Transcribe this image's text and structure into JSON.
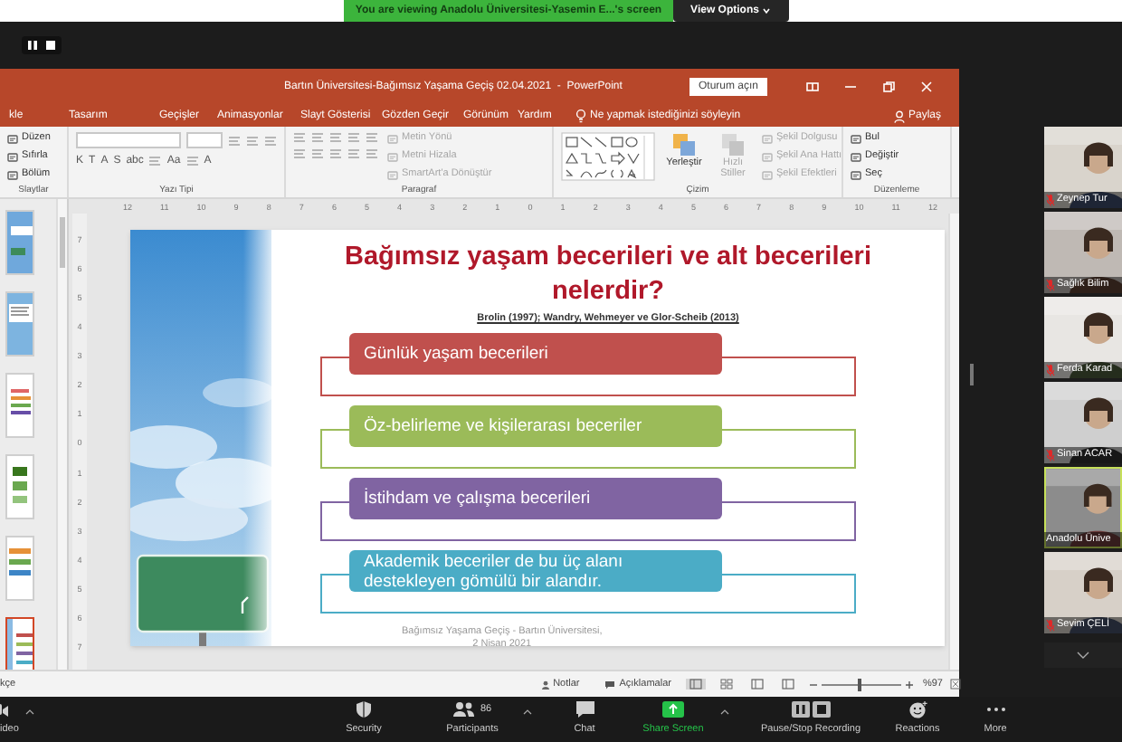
{
  "share_banner": {
    "text": "You are viewing Anadolu Üniversitesi-Yasemin E...'s screen",
    "view_options": "View Options"
  },
  "powerpoint": {
    "title": "Bartın Üniversitesi-Bağımsız Yaşama Geçiş 02.04.2021  -  PowerPoint",
    "sign_in": "Oturum açın",
    "tabs": [
      {
        "label": "kle",
        "selected": false
      },
      {
        "label": "Tasarım",
        "selected": false
      },
      {
        "label": "Geçişler",
        "selected": false
      },
      {
        "label": "Animasyonlar",
        "selected": false
      },
      {
        "label": "Slayt Gösterisi",
        "selected": false
      },
      {
        "label": "Gözden Geçir",
        "selected": false
      },
      {
        "label": "Görünüm",
        "selected": false
      },
      {
        "label": "Yardım",
        "selected": false
      }
    ],
    "tell_me": "Ne yapmak istediğinizi söyleyin",
    "share": "Paylaş",
    "ribbon": [
      {
        "label": "Slaytlar",
        "columns": [
          [
            [
              {
                "kind": "button",
                "label": "Düzen",
                "disabled": false
              }
            ],
            [
              {
                "kind": "button",
                "label": "Sıfırla",
                "disabled": false
              }
            ],
            [
              {
                "kind": "button",
                "label": "Bölüm",
                "disabled": false
              }
            ]
          ]
        ]
      },
      {
        "label": "Yazı Tipi",
        "columns": [
          [
            [
              {
                "kind": "field"
              },
              {
                "kind": "field"
              },
              {
                "kind": "icon"
              },
              {
                "kind": "icon"
              },
              {
                "kind": "icon"
              }
            ],
            [
              {
                "kind": "glyph",
                "label": "K"
              },
              {
                "kind": "glyph",
                "label": "T"
              },
              {
                "kind": "glyph",
                "label": "A"
              },
              {
                "kind": "glyph",
                "label": "S"
              },
              {
                "kind": "glyph",
                "label": "abc"
              },
              {
                "kind": "icon"
              },
              {
                "kind": "glyph",
                "label": "Aa"
              },
              {
                "kind": "icon"
              },
              {
                "kind": "glyph",
                "label": "A"
              }
            ]
          ]
        ]
      },
      {
        "label": "Paragraf",
        "columns": [
          [
            [
              {
                "kind": "icon"
              },
              {
                "kind": "icon"
              },
              {
                "kind": "icon"
              },
              {
                "kind": "icon"
              },
              {
                "kind": "icon"
              }
            ],
            [
              {
                "kind": "icon"
              },
              {
                "kind": "icon"
              },
              {
                "kind": "icon"
              },
              {
                "kind": "icon"
              },
              {
                "kind": "icon"
              }
            ]
          ],
          [
            [
              {
                "kind": "button",
                "label": "Metin Yönü",
                "disabled": true
              }
            ],
            [
              {
                "kind": "button",
                "label": "Metni Hizala",
                "disabled": true
              }
            ],
            [
              {
                "kind": "button",
                "label": "SmartArt'a Dönüştür",
                "disabled": true
              }
            ]
          ]
        ]
      },
      {
        "label": "Çizim",
        "columns": [
          [
            [
              {
                "kind": "gallery"
              }
            ]
          ],
          [
            [
              {
                "kind": "large",
                "label": "Yerleştir",
                "disabled": false
              }
            ]
          ],
          [
            [
              {
                "kind": "large",
                "label": "Hızlı Stiller",
                "disabled": true
              }
            ]
          ],
          [
            [
              {
                "kind": "button",
                "label": "Şekil Dolgusu",
                "disabled": true
              }
            ],
            [
              {
                "kind": "button",
                "label": "Şekil Ana Hattı",
                "disabled": true
              }
            ],
            [
              {
                "kind": "button",
                "label": "Şekil Efektleri",
                "disabled": true
              }
            ]
          ]
        ]
      },
      {
        "label": "Düzenleme",
        "columns": [
          [
            [
              {
                "kind": "button",
                "label": "Bul",
                "disabled": false
              }
            ],
            [
              {
                "kind": "button",
                "label": "Değiştir",
                "disabled": false
              }
            ],
            [
              {
                "kind": "button",
                "label": "Seç",
                "disabled": false
              }
            ]
          ]
        ]
      }
    ],
    "thumbnails": [
      {
        "selected": false
      },
      {
        "selected": false
      },
      {
        "selected": false
      },
      {
        "selected": false
      },
      {
        "selected": false
      },
      {
        "selected": true
      }
    ],
    "ruler": [
      "12",
      "11",
      "10",
      "9",
      "8",
      "7",
      "6",
      "5",
      "4",
      "3",
      "2",
      "1",
      "0",
      "1",
      "2",
      "3",
      "4",
      "5",
      "6",
      "7",
      "8",
      "9",
      "10",
      "11",
      "12"
    ],
    "vertical_ruler": [
      "7",
      "6",
      "5",
      "4",
      "3",
      "2",
      "1",
      "0",
      "1",
      "2",
      "3",
      "4",
      "5",
      "6",
      "7"
    ],
    "slide": {
      "title": "Bağımsız yaşam becerileri ve alt becerileri nelerdir?",
      "citation": "Brolin (1997); Wandry, Wehmeyer ve Glor-Scheib (2013)",
      "items": [
        {
          "text": "Günlük yaşam becerileri",
          "color": "#c0504d"
        },
        {
          "text": "Öz-belirleme ve kişilerarası beceriler",
          "color": "#9bbb59"
        },
        {
          "text": "İstihdam ve çalışma becerileri",
          "color": "#8064a2"
        },
        {
          "text": "Akademik beceriler de bu üç alanı destekleyen gömülü bir alandır.",
          "color": "#4bacc6"
        }
      ],
      "footer": [
        "Bağımsız Yaşama Geçiş - Bartın Üniversitesi,",
        "2 Nisan 2021"
      ]
    },
    "status_bar": {
      "language": "kçe",
      "notes": "Notlar",
      "comments": "Açıklamalar",
      "zoom": "%97",
      "zoom_level": {
        "level": 0.45
      }
    }
  },
  "participants": [
    {
      "name": "Zeynep Tur",
      "muted": true,
      "speaking": false
    },
    {
      "name": "Sağlık Bilim",
      "muted": true,
      "speaking": false
    },
    {
      "name": "Ferda Karad",
      "muted": true,
      "speaking": false
    },
    {
      "name": "Sinan ACAR",
      "muted": true,
      "speaking": false
    },
    {
      "name": "Anadolu Ünive",
      "muted": false,
      "speaking": true
    },
    {
      "name": "Sevim ÇELİ",
      "muted": true,
      "speaking": false
    }
  ],
  "toolbar": [
    {
      "kind": "video",
      "label": "ideo"
    },
    {
      "kind": "security",
      "label": "Security"
    },
    {
      "kind": "participants",
      "label": "Participants",
      "count": "86"
    },
    {
      "kind": "chat",
      "label": "Chat"
    },
    {
      "kind": "share",
      "label": "Share Screen"
    },
    {
      "kind": "record",
      "label": "Pause/Stop Recording"
    },
    {
      "kind": "reactions",
      "label": "Reactions"
    },
    {
      "kind": "more",
      "label": "More"
    }
  ]
}
